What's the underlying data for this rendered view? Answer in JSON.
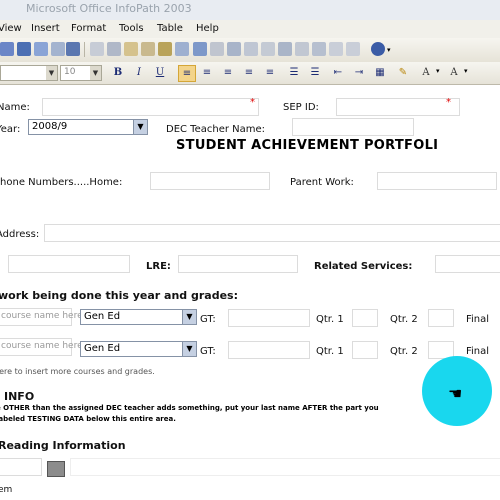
{
  "window": {
    "title": "Microsoft Office InfoPath 2003"
  },
  "menu": [
    "View",
    "Insert",
    "Format",
    "Tools",
    "Table",
    "Help"
  ],
  "toolbar": {
    "style_combo": "",
    "size_combo": "10",
    "format_buttons": [
      "B",
      "I",
      "U"
    ]
  },
  "form": {
    "name_label": "Name:",
    "sep_id_label": "SEP ID:",
    "year_label": "Year:",
    "year_value": "2008/9",
    "dec_teacher_label": "DEC Teacher Name:",
    "title": "STUDENT ACHIEVEMENT PORTFOLI",
    "phone_label": "Phone Numbers.....Home:",
    "parent_work_label": "Parent Work:",
    "address_label": "Address:",
    "lre_label": "LRE:",
    "related_services_label": "Related Services:",
    "coursework_heading": "work being done this year and grades:",
    "course_placeholder": "course name here.",
    "course_rows": [
      {
        "setting": "Gen Ed",
        "gt": "GT:",
        "q1": "Qtr. 1",
        "q2": "Qtr. 2",
        "final": "Final"
      },
      {
        "setting": "Gen Ed",
        "gt": "GT:",
        "q1": "Qtr. 1",
        "q2": "Qtr. 2",
        "final": "Final"
      }
    ],
    "insert_hint": "here to insert more courses and grades.",
    "info_heading": "INFO",
    "info_note_1": "e OTHER than the assigned DEC teacher adds something, put your last name AFTER the part you",
    "info_note_2": "labeled TESTING DATA below this entire area.",
    "reading_heading": "Reading Information",
    "bottom_label": "em"
  }
}
